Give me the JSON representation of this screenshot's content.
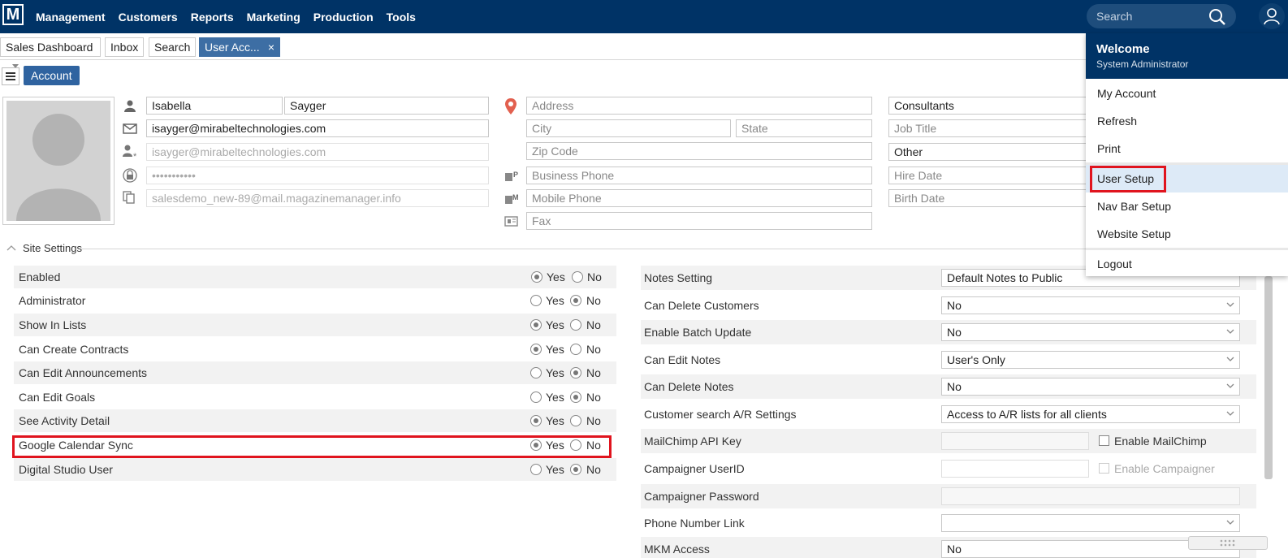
{
  "topnav": {
    "logo": "M",
    "menu": [
      "Management",
      "Customers",
      "Reports",
      "Marketing",
      "Production",
      "Tools"
    ],
    "search_placeholder": "Search"
  },
  "tabs": {
    "sales_dashboard": "Sales Dashboard",
    "inbox": "Inbox",
    "search": "Search",
    "user_account": "User Acc...",
    "close": "×"
  },
  "account_button": "Account",
  "profile": {
    "first_name": "Isabella",
    "last_name": "Sayger",
    "email": "isayger@mirabeltechnologies.com",
    "login": "isayger@mirabeltechnologies.com",
    "password": "•••••••••••",
    "alt_email": "salesdemo_new-89@mail.magazinemanager.info"
  },
  "address": {
    "address_ph": "Address",
    "city_ph": "City",
    "state_ph": "State",
    "zip_ph": "Zip Code",
    "business_phone_ph": "Business Phone",
    "mobile_phone_ph": "Mobile Phone",
    "fax_ph": "Fax"
  },
  "employment": {
    "department": "Consultants",
    "job_title_ph": "Job Title",
    "type": "Other",
    "hire_date_ph": "Hire Date",
    "birth_date_ph": "Birth Date"
  },
  "site_settings": {
    "label": "Site Settings",
    "yes": "Yes",
    "no": "No",
    "rows": [
      {
        "label": "Enabled",
        "value": "Yes"
      },
      {
        "label": "Administrator",
        "value": "No"
      },
      {
        "label": "Show In Lists",
        "value": "Yes"
      },
      {
        "label": "Can Create Contracts",
        "value": "Yes"
      },
      {
        "label": "Can Edit Announcements",
        "value": "No"
      },
      {
        "label": "Can Edit Goals",
        "value": "No"
      },
      {
        "label": "See Activity Detail",
        "value": "Yes"
      },
      {
        "label": "Google Calendar Sync",
        "value": "Yes"
      },
      {
        "label": "Digital Studio User",
        "value": "No"
      }
    ]
  },
  "right_settings": {
    "notes_setting": {
      "label": "Notes Setting",
      "value": "Default Notes to Public"
    },
    "can_delete_customers": {
      "label": "Can Delete Customers",
      "value": "No"
    },
    "enable_batch_update": {
      "label": "Enable Batch Update",
      "value": "No"
    },
    "can_edit_notes": {
      "label": "Can Edit Notes",
      "value": "User's Only"
    },
    "can_delete_notes": {
      "label": "Can Delete Notes",
      "value": "No"
    },
    "ar_settings": {
      "label": "Customer search A/R Settings",
      "value": "Access to A/R lists for all clients"
    },
    "mailchimp_key": {
      "label": "MailChimp API Key",
      "checkbox": "Enable MailChimp"
    },
    "campaigner_user": {
      "label": "Campaigner UserID",
      "checkbox": "Enable Campaigner"
    },
    "campaigner_password": {
      "label": "Campaigner Password"
    },
    "phone_link": {
      "label": "Phone Number Link",
      "value": ""
    },
    "mkm_access": {
      "label": "MKM Access",
      "value": "No"
    }
  },
  "user_menu": {
    "welcome": "Welcome",
    "role": "System Administrator",
    "items": [
      "My Account",
      "Refresh",
      "Print",
      "User Setup",
      "Nav Bar Setup",
      "Website Setup",
      "Logout"
    ]
  },
  "colors": {
    "nav": "#003366",
    "accent": "#2f63a0",
    "highlight": "#e0141e"
  }
}
